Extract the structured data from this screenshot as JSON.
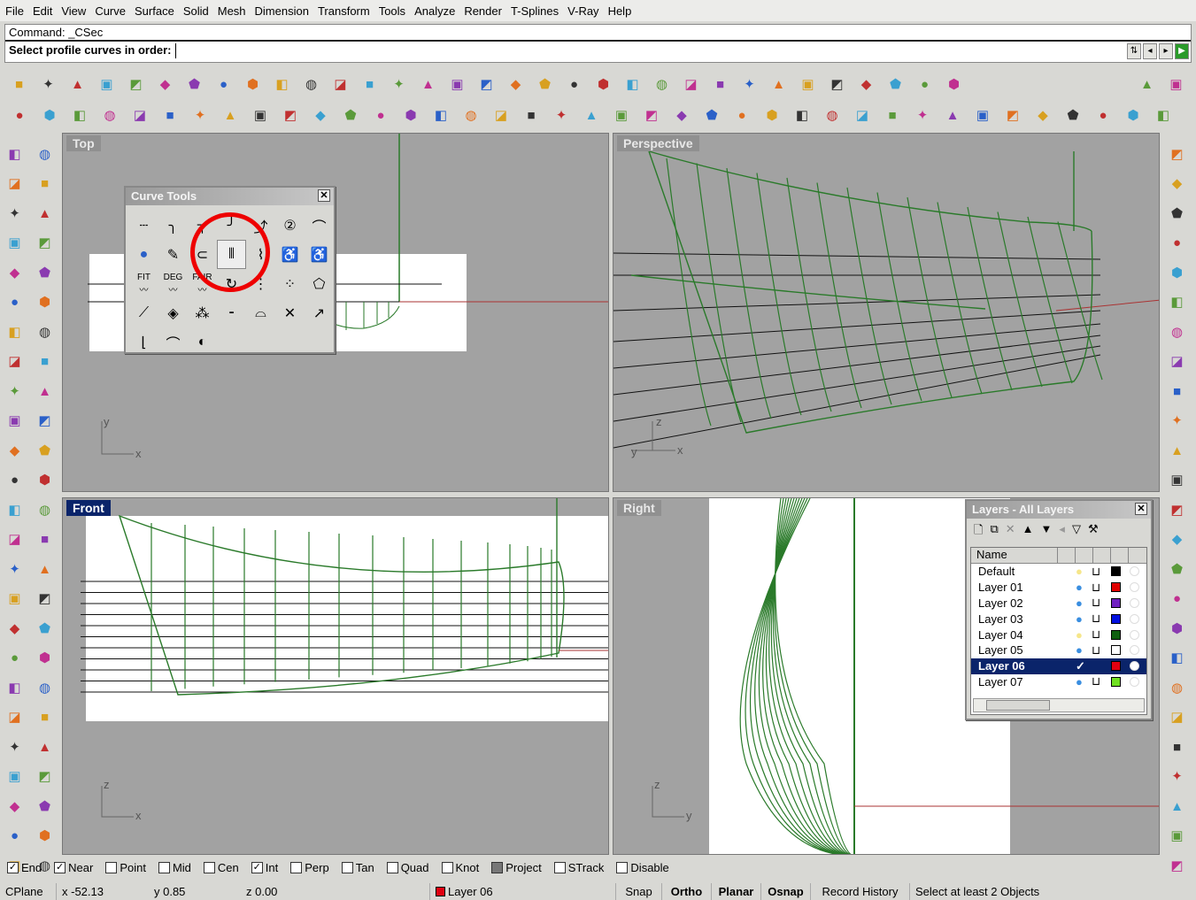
{
  "menu": [
    "File",
    "Edit",
    "View",
    "Curve",
    "Surface",
    "Solid",
    "Mesh",
    "Dimension",
    "Transform",
    "Tools",
    "Analyze",
    "Render",
    "T-Splines",
    "V-Ray",
    "Help"
  ],
  "command": {
    "history": "Command: _CSec",
    "prompt": "Select profile curves in order:",
    "input": ""
  },
  "toolbar_row1": [
    "new-icon",
    "open-icon",
    "save-icon",
    "print-icon",
    "export-icon",
    "cut-icon",
    "copy-icon",
    "paste-icon",
    "undo-icon",
    "pan-icon",
    "rotate-view-icon",
    "zoom-icon",
    "zoom-window-icon",
    "zoom-extents-icon",
    "zoom-selected-icon",
    "undo-view-icon",
    "four-viewports-icon",
    "car-icon",
    "grid-plane-icon",
    "cplane-icon",
    "osnap-icon",
    "light-icon",
    "lock-icon",
    "material-icon",
    "color-wheel-icon",
    "wireframe-sphere-icon",
    "mesh-sphere-icon",
    "render-sphere-icon",
    "spotlight-icon",
    "options-gear-icon",
    "dimension-icon",
    "box-properties-icon",
    "help-icon"
  ],
  "toolbar_row1_right": [
    "maximize-viewport-icon",
    "render-go-icon"
  ],
  "toolbar_row2": [
    "tag-icon",
    "tag2-icon",
    "tag3-icon",
    "cube-icon",
    "sun-icon",
    "diamond-icon",
    "sphere-outline-icon",
    "box-blue-icon",
    "box-pink-icon",
    "box-frame-icon",
    "twist-icon",
    "taper-icon",
    "axes-icon",
    "solid-cube-icon",
    "boolean-icon",
    "rotate-arrows-icon",
    "polygon-icon",
    "fold-icon",
    "arch-icon",
    "curl-icon",
    "flag-icon",
    "extrude-icon",
    "array-icon",
    "array-grid-icon",
    "frame-icon",
    "mirror-icon",
    "grid-icon",
    "grid-pink-icon",
    "boxes-icon",
    "stretch-icon",
    "flip-icon",
    "star-arrow-icon",
    "eraser-icon",
    "comb-icon",
    "wave-icon",
    "cross-icon",
    "shape-icon",
    "explode-icon",
    "axis-icon"
  ],
  "left_toolbar": [
    "select-arrow-icon",
    "point-icon",
    "polyline-icon",
    "rectangle-curve-icon",
    "circle-icon",
    "ellipse-icon",
    "polygon-curve-icon",
    "rectangle-icon",
    "arc-icon",
    "fillet-curve-icon",
    "surface-icon",
    "sweep-icon",
    "box-solid-icon",
    "sphere-solid-icon",
    "cylinder-icon",
    "plane-icon",
    "gumball-icon",
    "explode-icon",
    "trim-icon",
    "split-icon",
    "group-icon",
    "ungroup-icon",
    "fillet-icon",
    "chamfer-icon",
    "text-icon",
    "dimension-icon",
    "array-icon",
    "scale-icon",
    "block-icon",
    "hatch-icon",
    "mirror-icon",
    "align-icon",
    "rotate-icon",
    "mesh-icon",
    "sphere-mesh-icon",
    "layer-stack-icon",
    "grid-mesh-icon",
    "extrude-icon",
    "frame-icon",
    "rebuild-icon",
    "slice-icon",
    "solid-box-icon",
    "curve-edit-icon",
    "join-icon",
    "taper-icon",
    "orient-icon",
    "bend-icon",
    "twist-icon",
    "cage-icon",
    "move-icon"
  ],
  "right_toolbar": [
    "curve-points-icon",
    "dimension-angle-icon",
    "boxes-icon",
    "edit-points-icon",
    "box-blue-icon",
    "symmetry-icon",
    "diamond-icon",
    "control-point-icon",
    "adjust-icon",
    "match-icon",
    "frame-icon",
    "grid-dots-icon",
    "circle-dots-icon",
    "green-plane-icon",
    "network-icon",
    "pipe-icon",
    "blend-icon",
    "loft-icon",
    "revolve-icon",
    "sweep-icon",
    "patch-icon",
    "curve-network-icon",
    "offset-icon",
    "zebra-icon",
    "sphere-grid-icon"
  ],
  "viewports": {
    "top": "Top",
    "perspective": "Perspective",
    "front": "Front",
    "right": "Right"
  },
  "axes": {
    "top": [
      "y",
      "x"
    ],
    "front": [
      "z",
      "x"
    ],
    "right": [
      "z",
      "y"
    ],
    "perspective": [
      "z",
      "y",
      "x"
    ]
  },
  "curve_tools": {
    "title": "Curve Tools",
    "icons": [
      "extend-curve-icon",
      "fillet-corners-icon",
      "chamfer-curve-icon",
      "blend-curve-icon",
      "offset-curve-icon",
      "curve-degree-icon",
      "adjustable-blend-icon",
      "control-point-sphere-icon",
      "curve-from-surface-icon",
      "curve-boolean-icon",
      "cross-section-curves-icon",
      "polyline-edit-icon",
      "worker-cart-icon",
      "worker-icon",
      "fit-curve-icon",
      "degree-curve-icon",
      "fair-curve-icon",
      "handle-curve-icon",
      "insert-knot-icon",
      "point-circle-icon",
      "polygon-curve-icon",
      "adjust-seam-icon",
      "edit-point-icon",
      "insert-points-icon",
      "remove-points-icon",
      "add-point-icon",
      "delete-point-icon",
      "move-point-icon",
      "trim-end-icon",
      "drape-icon",
      "region-boolean-icon"
    ],
    "labels": {
      "fit": "FIT",
      "deg": "DEG",
      "fair": "FAIR"
    }
  },
  "layers": {
    "title": "Layers - All Layers",
    "column": "Name",
    "rows": [
      {
        "name": "Default",
        "on": true,
        "bulb": "#f6e68a",
        "color": "#000000"
      },
      {
        "name": "Layer 01",
        "bulb": "#3a8ee0",
        "color": "#e00000"
      },
      {
        "name": "Layer 02",
        "bulb": "#3a8ee0",
        "color": "#7020c0"
      },
      {
        "name": "Layer 03",
        "bulb": "#3a8ee0",
        "color": "#0010e0"
      },
      {
        "name": "Layer 04",
        "bulb": "#f6e68a",
        "color": "#106010"
      },
      {
        "name": "Layer 05",
        "bulb": "#3a8ee0",
        "color": "#ffffff"
      },
      {
        "name": "Layer 06",
        "current": true,
        "color": "#e00010"
      },
      {
        "name": "Layer 07",
        "bulb": "#3a8ee0",
        "color": "#70e020"
      }
    ]
  },
  "osnap": [
    {
      "label": "End",
      "checked": true
    },
    {
      "label": "Near",
      "checked": true
    },
    {
      "label": "Point",
      "checked": false
    },
    {
      "label": "Mid",
      "checked": false
    },
    {
      "label": "Cen",
      "checked": false
    },
    {
      "label": "Int",
      "checked": true
    },
    {
      "label": "Perp",
      "checked": false
    },
    {
      "label": "Tan",
      "checked": false
    },
    {
      "label": "Quad",
      "checked": false
    },
    {
      "label": "Knot",
      "checked": false
    },
    {
      "label": "Project",
      "checked": false
    },
    {
      "label": "STrack",
      "checked": false
    },
    {
      "label": "Disable",
      "checked": false
    }
  ],
  "status": {
    "cplane": "CPlane",
    "x": "x -52.13",
    "y": "y 0.85",
    "z": "z 0.00",
    "layer": "Layer 06",
    "layer_color": "#e00010",
    "snap": "Snap",
    "ortho": "Ortho",
    "planar": "Planar",
    "osnap": "Osnap",
    "record": "Record History",
    "message": "Select at least 2 Objects"
  }
}
